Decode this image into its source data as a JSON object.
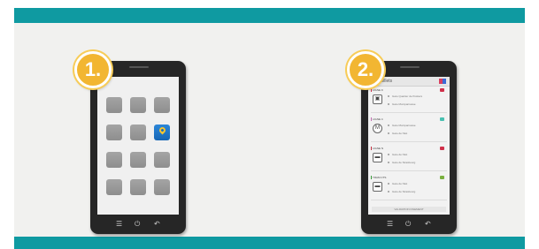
{
  "steps": [
    {
      "number": "1."
    },
    {
      "number": "2."
    }
  ],
  "home_screen": {
    "apps": [
      {
        "icon": "app-icon"
      },
      {
        "icon": "app-icon"
      },
      {
        "icon": "app-icon"
      },
      {
        "icon": "app-icon"
      },
      {
        "icon": "app-icon"
      },
      {
        "icon": "map-pin-icon"
      },
      {
        "icon": "app-icon"
      },
      {
        "icon": "app-icon"
      },
      {
        "icon": "app-icon"
      },
      {
        "icon": "app-icon"
      },
      {
        "icon": "app-icon"
      },
      {
        "icon": "app-icon"
      }
    ]
  },
  "tickets_screen": {
    "title": "Mes Billets",
    "tickets": [
      {
        "line": "LIGNE 9",
        "icon": "bus-icon",
        "from": "Gare Quartier de Postiers",
        "to": "Gare Montparnasse",
        "color": "#d0304a",
        "tag_color": "#d0304a"
      },
      {
        "line": "LIGNE 4",
        "icon": "metro-icon",
        "from": "Gare Montparnasse",
        "to": "Gare de l'Est",
        "color": "#c06ab0",
        "tag_color": "#48c0b0"
      },
      {
        "line": "LIGNE N",
        "icon": "train-icon",
        "from": "Gare de l'Est",
        "to": "Gare de Strasbourg",
        "color": "#c03040",
        "tag_color": "#d0304a"
      },
      {
        "line": "TRAM CTS",
        "icon": "tram-icon",
        "from": "Gare de l'Est",
        "to": "Gare de Strasbourg",
        "color": "#3a9a3a",
        "tag_color": "#7ab040"
      }
    ],
    "button": "VALIDATION PAIEMENT"
  },
  "colors": {
    "band": "#0f9aa1",
    "badge": "#f2b632",
    "panel": "#f1f1ef"
  }
}
